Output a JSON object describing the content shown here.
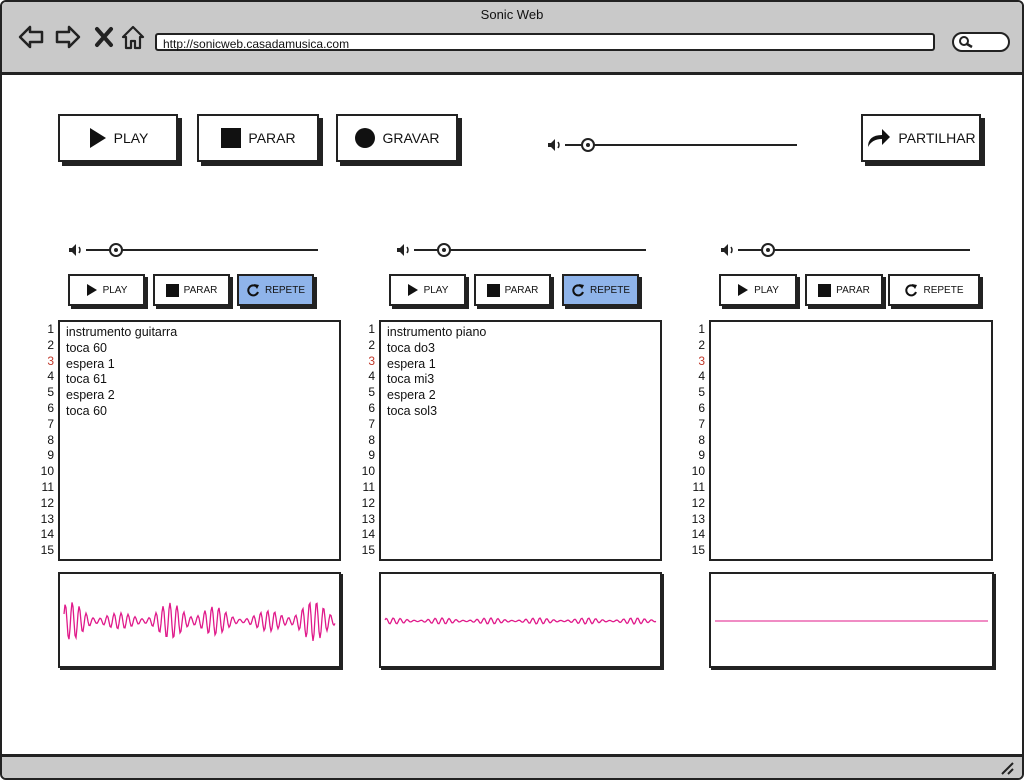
{
  "window": {
    "title": "Sonic Web",
    "url": "http://sonicweb.casadamusica.com"
  },
  "toolbar": {
    "play_label": "PLAY",
    "stop_label": "PARAR",
    "record_label": "GRAVAR",
    "share_label": "PARTILHAR",
    "master_volume": 0.07
  },
  "colors": {
    "accent": "#8fb4ea",
    "wave": "#e0198a",
    "highlight_line": "#c0392b"
  },
  "line_numbers": [
    "1",
    "2",
    "3",
    "4",
    "5",
    "6",
    "7",
    "8",
    "9",
    "10",
    "11",
    "12",
    "13",
    "14",
    "15"
  ],
  "tracks": [
    {
      "play_label": "PLAY",
      "stop_label": "PARAR",
      "repeat_label": "REPETE",
      "repeat_active": true,
      "volume": 0.1,
      "lines": [
        "instrumento guitarra",
        "toca 60",
        "espera 1",
        "toca 61",
        "espera 2",
        "toca 60"
      ],
      "wave": "high"
    },
    {
      "play_label": "PLAY",
      "stop_label": "PARAR",
      "repeat_label": "REPETE",
      "repeat_active": true,
      "volume": 0.1,
      "lines": [
        "instrumento piano",
        "toca do3",
        "espera 1",
        "toca mi3",
        "espera 2",
        "toca sol3"
      ],
      "wave": "low"
    },
    {
      "play_label": "PLAY",
      "stop_label": "PARAR",
      "repeat_label": "REPETE",
      "repeat_active": false,
      "volume": 0.1,
      "lines": [],
      "wave": "flat"
    }
  ],
  "icons": [
    "back-arrow-icon",
    "forward-arrow-icon",
    "close-icon",
    "home-icon",
    "search-icon",
    "play-icon",
    "stop-icon",
    "record-icon",
    "share-icon",
    "volume-icon",
    "repeat-icon",
    "resize-grip-icon"
  ]
}
